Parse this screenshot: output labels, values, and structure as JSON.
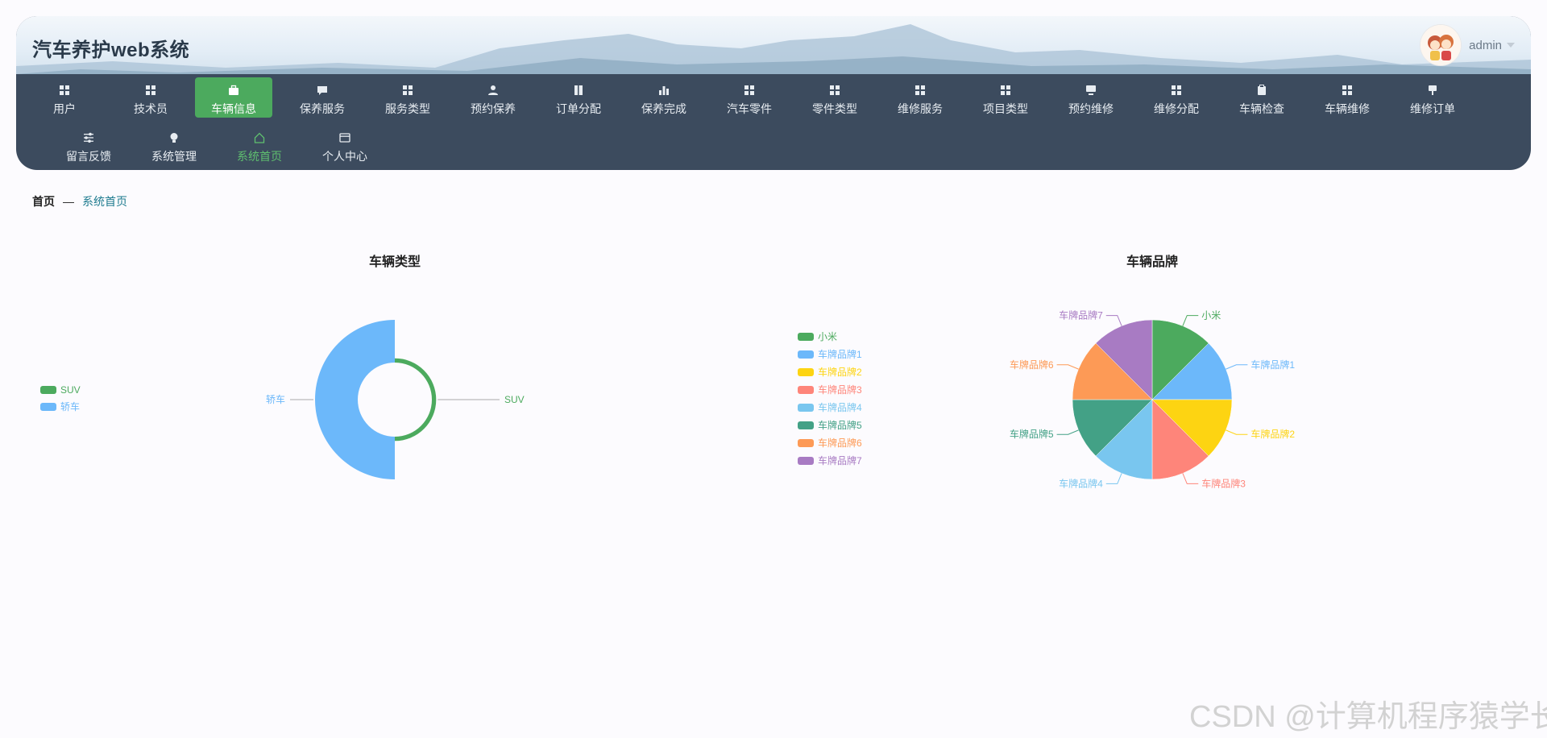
{
  "header": {
    "app_title": "汽车养护web系统",
    "username": "admin"
  },
  "nav": {
    "items": [
      {
        "label": "用户",
        "icon": "grid-icon"
      },
      {
        "label": "技术员",
        "icon": "grid-icon"
      },
      {
        "label": "车辆信息",
        "icon": "briefcase-icon"
      },
      {
        "label": "保养服务",
        "icon": "chat-icon"
      },
      {
        "label": "服务类型",
        "icon": "grid-icon"
      },
      {
        "label": "预约保养",
        "icon": "user-icon"
      },
      {
        "label": "订单分配",
        "icon": "book-icon"
      },
      {
        "label": "保养完成",
        "icon": "bar-chart-icon"
      },
      {
        "label": "汽车零件",
        "icon": "grid-icon"
      },
      {
        "label": "零件类型",
        "icon": "grid-icon"
      },
      {
        "label": "维修服务",
        "icon": "grid-icon"
      },
      {
        "label": "项目类型",
        "icon": "grid-icon"
      },
      {
        "label": "预约维修",
        "icon": "monitor-icon"
      },
      {
        "label": "维修分配",
        "icon": "grid-icon"
      },
      {
        "label": "车辆检查",
        "icon": "clipboard-icon"
      },
      {
        "label": "车辆维修",
        "icon": "grid-icon"
      },
      {
        "label": "维修订单",
        "icon": "pin-icon"
      },
      {
        "label": "留言反馈",
        "icon": "sliders-icon"
      },
      {
        "label": "系统管理",
        "icon": "bulb-icon"
      },
      {
        "label": "系统首页",
        "icon": "home-icon"
      },
      {
        "label": "个人中心",
        "icon": "id-card-icon"
      }
    ],
    "active_index": 2,
    "current_index": 19
  },
  "breadcrumb": {
    "home": "首页",
    "separator": "—",
    "current": "系统首页"
  },
  "colors": {
    "green": "#4caa5e",
    "blue": "#6cb8fa",
    "yellow": "#fdd412",
    "salmon": "#fe857a",
    "skyblue": "#79c6ef",
    "teal": "#43a186",
    "orange": "#fd9a56",
    "purple": "#a87bc3"
  },
  "chart_data": [
    {
      "type": "pie",
      "variant": "rose-donut",
      "title": "车辆类型",
      "legend_position": "left",
      "categories": [
        "SUV",
        "轿车"
      ],
      "values": [
        1,
        10
      ],
      "colors": [
        "#4caa5e",
        "#6cb8fa"
      ]
    },
    {
      "type": "pie",
      "title": "车辆品牌",
      "legend_position": "left",
      "categories": [
        "小米",
        "车牌品牌1",
        "车牌品牌2",
        "车牌品牌3",
        "车牌品牌4",
        "车牌品牌5",
        "车牌品牌6",
        "车牌品牌7"
      ],
      "values": [
        1,
        1,
        1,
        1,
        1,
        1,
        1,
        1
      ],
      "colors": [
        "#4caa5e",
        "#6cb8fa",
        "#fdd412",
        "#fe857a",
        "#79c6ef",
        "#43a186",
        "#fd9a56",
        "#a87bc3"
      ]
    }
  ],
  "watermark": "CSDN @计算机程序猿学长"
}
